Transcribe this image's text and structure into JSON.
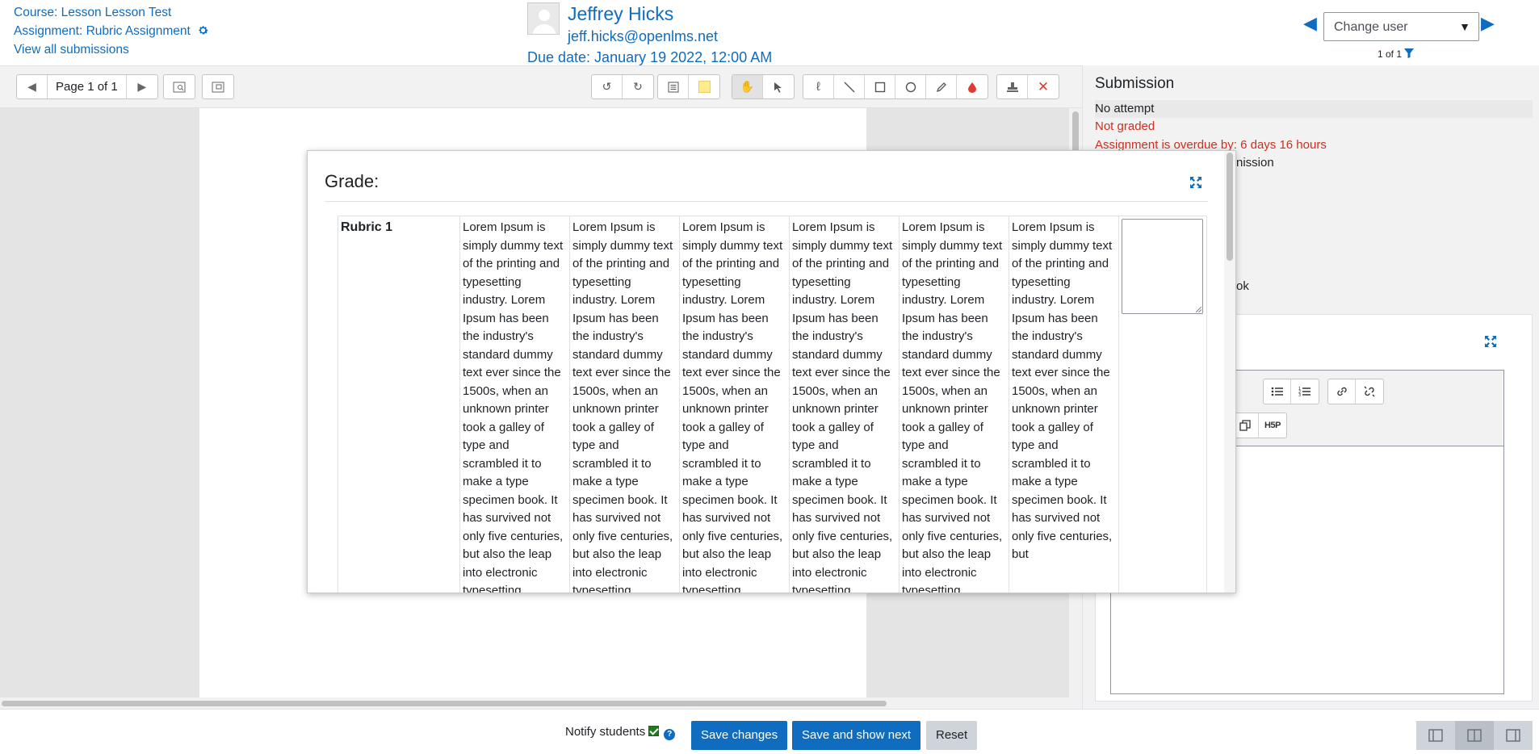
{
  "header": {
    "course": "Course: Lesson Lesson Test",
    "assignment": "Assignment: Rubric Assignment",
    "view_all": "View all submissions",
    "user_name": "Jeffrey Hicks",
    "user_email": "jeff.hicks@openlms.net",
    "due_date": "Due date: January 19 2022, 12:00 AM",
    "change_user_placeholder": "Change user",
    "user_count": "1 of 1"
  },
  "toolbar": {
    "page_label": "Page 1 of 1"
  },
  "submission": {
    "title": "Submission",
    "status": "No attempt",
    "grading": "Not graded",
    "overdue": "Assignment is overdue by: 6 days 16 hours",
    "partial_1": "nission",
    "partial_2": "ok"
  },
  "modal": {
    "title": "Grade:",
    "criterion": "Rubric 1",
    "levels": [
      "Lorem Ipsum is simply dummy text of the printing and typesetting industry. Lorem Ipsum has been the industry's standard dummy text ever since the 1500s, when an unknown printer took a galley of type and scrambled it to make a type specimen book. It has survived not only five centuries, but also the leap into electronic typesetting",
      "Lorem Ipsum is simply dummy text of the printing and typesetting industry. Lorem Ipsum has been the industry's standard dummy text ever since the 1500s, when an unknown printer took a galley of type and scrambled it to make a type specimen book. It has survived not only five centuries, but also the leap into electronic typesetting",
      "Lorem Ipsum is simply dummy text of the printing and typesetting industry. Lorem Ipsum has been the industry's standard dummy text ever since the 1500s, when an unknown printer took a galley of type and scrambled it to make a type specimen book. It has survived not only five centuries, but also the leap into electronic typesetting",
      "Lorem Ipsum is simply dummy text of the printing and typesetting industry. Lorem Ipsum has been the industry's standard dummy text ever since the 1500s, when an unknown printer took a galley of type and scrambled it to make a type specimen book. It has survived not only five centuries, but also the leap into electronic typesetting",
      "Lorem Ipsum is simply dummy text of the printing and typesetting industry. Lorem Ipsum has been the industry's standard dummy text ever since the 1500s, when an unknown printer took a galley of type and scrambled it to make a type specimen book. It has survived not only five centuries, but also the leap into electronic typesetting",
      "Lorem Ipsum is simply dummy text of the printing and typesetting industry. Lorem Ipsum has been the industry's standard dummy text ever since the 1500s, when an unknown printer took a galley of type and scrambled it to make a type specimen book. It has survived not only five centuries, but"
    ]
  },
  "footer": {
    "notify_label": "Notify students",
    "notify_checked": true,
    "save_changes": "Save changes",
    "save_and_next": "Save and show next",
    "reset": "Reset"
  },
  "colors": {
    "link": "#0f6cbf",
    "error": "#ca3120",
    "primary": "#0f6cbf"
  },
  "icons": {
    "settings": "gear-icon",
    "prev": "triangle-left-icon",
    "next": "triangle-right-icon",
    "filter": "filter-icon",
    "expand": "expand-icon"
  }
}
